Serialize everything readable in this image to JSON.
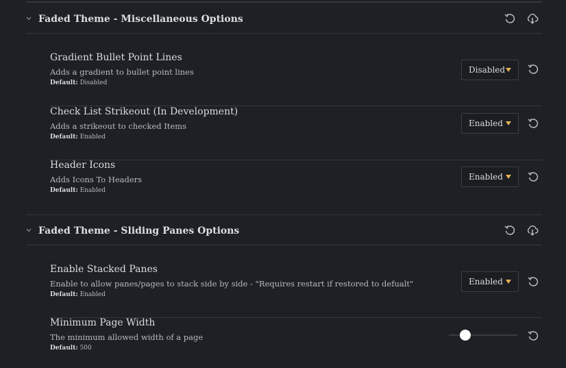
{
  "sections": [
    {
      "title": "Faded Theme - Miscellaneous Options",
      "settings": [
        {
          "name": "Gradient Bullet Point Lines",
          "description": "Adds a gradient to bullet point lines",
          "default_label": "Default:",
          "default_value": "Disabled",
          "control": "Disabled"
        },
        {
          "name": "Check List Strikeout (In Development)",
          "description": "Adds a strikeout to checked Items",
          "default_label": "Default:",
          "default_value": "Enabled",
          "control": "Enabled"
        },
        {
          "name": "Header Icons",
          "description": "Adds Icons To Headers",
          "default_label": "Default:",
          "default_value": "Enabled",
          "control": "Enabled"
        }
      ]
    },
    {
      "title": "Faded Theme - Sliding Panes Options",
      "settings": [
        {
          "name": "Enable Stacked Panes",
          "description": "Enable to allow panes/pages to stack side by side - \"Requires restart if restored to defualt\"",
          "default_label": "Default:",
          "default_value": "Enabled",
          "control": "Enabled"
        },
        {
          "name": "Minimum Page Width",
          "description": "The minimum allowed width of a page",
          "default_label": "Default:",
          "default_value": "500",
          "slider_fraction": 0.24
        }
      ]
    }
  ],
  "icons": {
    "collapse": "chevron-down-icon",
    "reset": "reset-icon",
    "export": "download-icon"
  },
  "colors": {
    "background": "#1d2024",
    "accent": "#e6b15a",
    "divider": "#34373c"
  }
}
